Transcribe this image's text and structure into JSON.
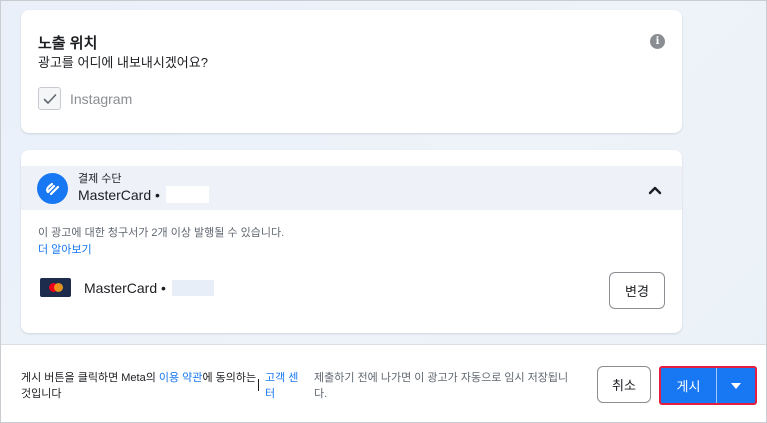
{
  "placement": {
    "title": "노출 위치",
    "subtitle": "광고를 어디에 내보내시겠어요?",
    "info_icon": "info-icon",
    "platform_label": "Instagram",
    "platform_checked": true
  },
  "payment": {
    "section_label": "결제 수단",
    "method_name": "MasterCard •",
    "billing_note": "이 광고에 대한 청구서가 2개 이상 발행될 수 있습니다.",
    "learn_more": "더 알아보기",
    "card_name": "MasterCard •",
    "change_label": "변경",
    "collapse_icon": "chevron-up-icon"
  },
  "footer": {
    "consent_prefix": "게시 버튼을 클릭하면 Meta의 ",
    "terms_link": "이용 약관",
    "consent_suffix": "에 동의하는 것입니다",
    "help_center": "고객 센터",
    "autosave_note": "제출하기 전에 나가면 이 광고가 자동으로 임시 저장됩니다.",
    "cancel_label": "취소",
    "publish_label": "게시"
  },
  "colors": {
    "accent": "#1877f2",
    "highlight_border": "#e41e3f",
    "header_band": "#eef2f8"
  }
}
